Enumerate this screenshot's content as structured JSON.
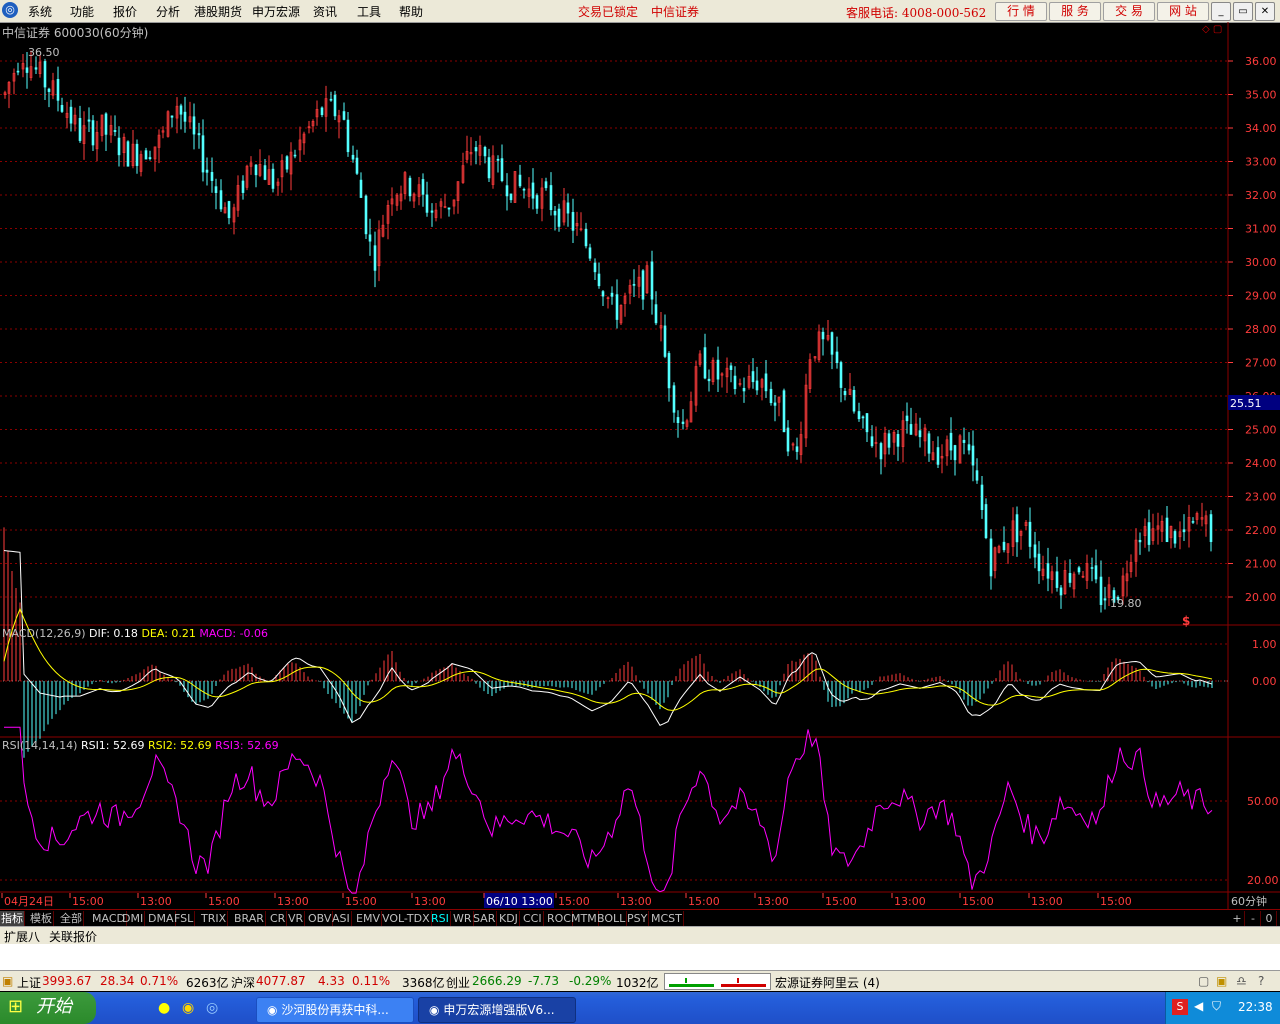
{
  "menubar": {
    "items": [
      "系统",
      "功能",
      "报价",
      "分析",
      "港股期货",
      "申万宏源",
      "资讯",
      "工具",
      "帮助"
    ],
    "status_locked": "交易已锁定",
    "broker": "中信证券",
    "hotline": "客服电话: 4008-000-562",
    "buttons": [
      "行 情",
      "服 务",
      "交 易",
      "网 站"
    ]
  },
  "chart": {
    "title": "中信证券 600030(60分钟)",
    "high_label": "36.50",
    "low_label": "19.80",
    "current_price": "25.51",
    "price_ticks": [
      "36.00",
      "35.00",
      "34.00",
      "33.00",
      "32.00",
      "31.00",
      "30.00",
      "29.00",
      "28.00",
      "27.00",
      "26.00",
      "25.00",
      "24.00",
      "23.00",
      "22.00",
      "21.00",
      "20.00"
    ],
    "colors": {
      "up": "#ff3c3c",
      "down": "#54ffff",
      "grid": "#8b0000",
      "axis_text": "#ff3c3c"
    }
  },
  "macd": {
    "name": "MACD(12,26,9)",
    "dif_label": "DIF: 0.18",
    "dea_label": "DEA: 0.21",
    "macd_label": "MACD: -0.06",
    "ticks": [
      "1.00",
      "0.00"
    ]
  },
  "rsi": {
    "name": "RSI(14,14,14)",
    "rsi1_label": "RSI1: 52.69",
    "rsi2_label": "RSI2: 52.69",
    "rsi3_label": "RSI3: 52.69",
    "ticks": [
      "50.00",
      "20.00"
    ]
  },
  "xaxis": {
    "labels": [
      "04月24日",
      "15:00",
      "13:00",
      "15:00",
      "13:00",
      "15:00",
      "13:00",
      "06/10 13:00",
      "15:00",
      "13:00",
      "15:00",
      "13:00",
      "15:00",
      "13:00",
      "15:00",
      "13:00",
      "15:00"
    ],
    "period": "60分钟",
    "zoom_buttons": [
      "+",
      "-",
      "0"
    ]
  },
  "tabs": [
    "指标",
    "模板",
    "全部",
    "MACD",
    "DMI",
    "DMA",
    "FSL",
    "TRIX",
    "BRAR",
    "CR",
    "VR",
    "OBV",
    "ASI",
    "EMV",
    "VOL-TDX",
    "RSI",
    "WR",
    "SAR",
    "KDJ",
    "CCI",
    "ROC",
    "MTM",
    "BOLL",
    "PSY",
    "MCST"
  ],
  "ext_tabs": [
    "扩展八",
    "关联报价"
  ],
  "statusbar": {
    "sh_name": "上证",
    "sh_value": "3993.67",
    "sh_change": "28.34",
    "sh_pct": "0.71%",
    "sh_vol": "6263亿",
    "sz_name": "沪深",
    "sz_value": "4077.87",
    "sz_change": "4.33",
    "sz_pct": "0.11%",
    "sz_vol": "3368亿",
    "cy_name": "创业",
    "cy_value": "2666.29",
    "cy_change": "-7.73",
    "cy_pct": "-0.29%",
    "cy_vol": "1032亿",
    "cloud_label": "宏源证券阿里云 (4)"
  },
  "taskbar": {
    "start_label": "开始",
    "tasks": [
      "沙河股份再获中科...",
      "申万宏源增强版V6..."
    ],
    "clock": "22:38"
  }
}
